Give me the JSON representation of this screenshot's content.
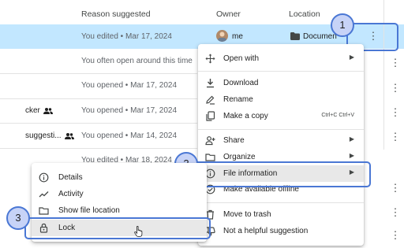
{
  "header": {
    "reason_suggested": "Reason suggested",
    "owner": "Owner",
    "location": "Location"
  },
  "rows": [
    {
      "name": "",
      "reason": "You edited • Mar 17, 2024",
      "owner": "me",
      "location": "Documen"
    },
    {
      "name": "",
      "reason": "You often open around this time",
      "owner": "",
      "location": ""
    },
    {
      "name": "",
      "reason": "You opened • Mar 17, 2024",
      "owner": "",
      "location": ""
    },
    {
      "name": "cker",
      "reason": "You opened • Mar 17, 2024",
      "owner": "",
      "location": ""
    },
    {
      "name": "suggesti...",
      "reason": "You opened • Mar 14, 2024",
      "owner": "",
      "location": ""
    },
    {
      "name": "",
      "reason": "You edited • Mar 18, 2024",
      "owner": "",
      "location": ""
    }
  ],
  "context_menu": {
    "open_with": "Open with",
    "download": "Download",
    "rename": "Rename",
    "make_copy": "Make a copy",
    "make_copy_shortcut": "Ctrl+C Ctrl+V",
    "share": "Share",
    "organize": "Organize",
    "file_information": "File information",
    "make_available_offline": "Make available offline",
    "move_to_trash": "Move to trash",
    "not_helpful": "Not a helpful suggestion"
  },
  "submenu": {
    "details": "Details",
    "activity": "Activity",
    "show_file_location": "Show file location",
    "lock": "Lock"
  },
  "callouts": {
    "one": "1",
    "two": "2",
    "three": "3"
  },
  "colors": {
    "selected_row": "#c2e7ff",
    "callout_border": "#4a77d4",
    "callout_fill": "#c7d3f7",
    "hover_item": "#e8e8e8"
  }
}
